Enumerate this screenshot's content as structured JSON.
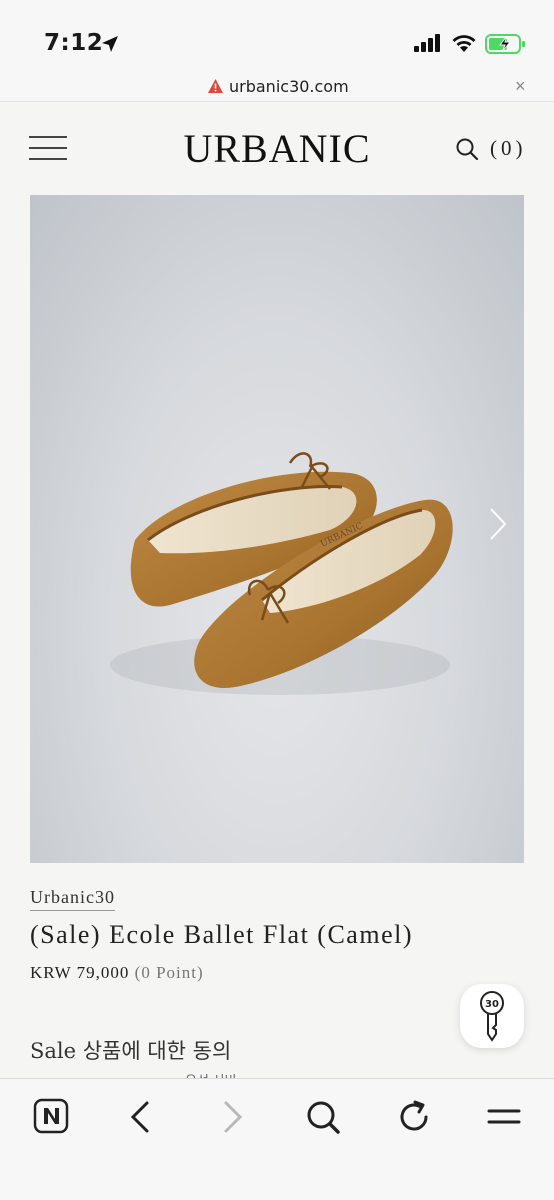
{
  "status_bar": {
    "time": "7:12",
    "location_icon": "location-arrow-icon",
    "signal_icon": "cellular-signal-icon",
    "wifi_icon": "wifi-icon",
    "battery_icon": "battery-charging-icon"
  },
  "address_bar": {
    "warning_icon": "warning-triangle-icon",
    "url": "urbanic30.com",
    "close_label": "×"
  },
  "header": {
    "menu_icon": "hamburger-menu-icon",
    "logo": "URBANIC",
    "search_icon": "search-icon",
    "cart_count": "(0)"
  },
  "product": {
    "image_alt": "Camel suede ballet flats",
    "next_icon": "chevron-right-icon",
    "brand": "Urbanic30",
    "title": "(Sale) Ecole Ballet Flat (Camel)",
    "price": "KRW 79,000",
    "points": "(0 Point)",
    "sale_note": "Sale 상품에 대한 동의",
    "sale_note_extra": "우선 서비"
  },
  "floating_button": {
    "icon": "key-30-icon",
    "label": "30"
  },
  "toolbar": {
    "items": [
      {
        "icon": "naver-n-icon"
      },
      {
        "icon": "back-arrow-icon"
      },
      {
        "icon": "forward-arrow-icon"
      },
      {
        "icon": "search-icon"
      },
      {
        "icon": "reload-icon"
      },
      {
        "icon": "menu-icon"
      }
    ]
  },
  "colors": {
    "background": "#f5f5f4",
    "shoe_camel": "#b07a3a",
    "warning_red": "#e0463a",
    "battery_green": "#4cd964"
  }
}
